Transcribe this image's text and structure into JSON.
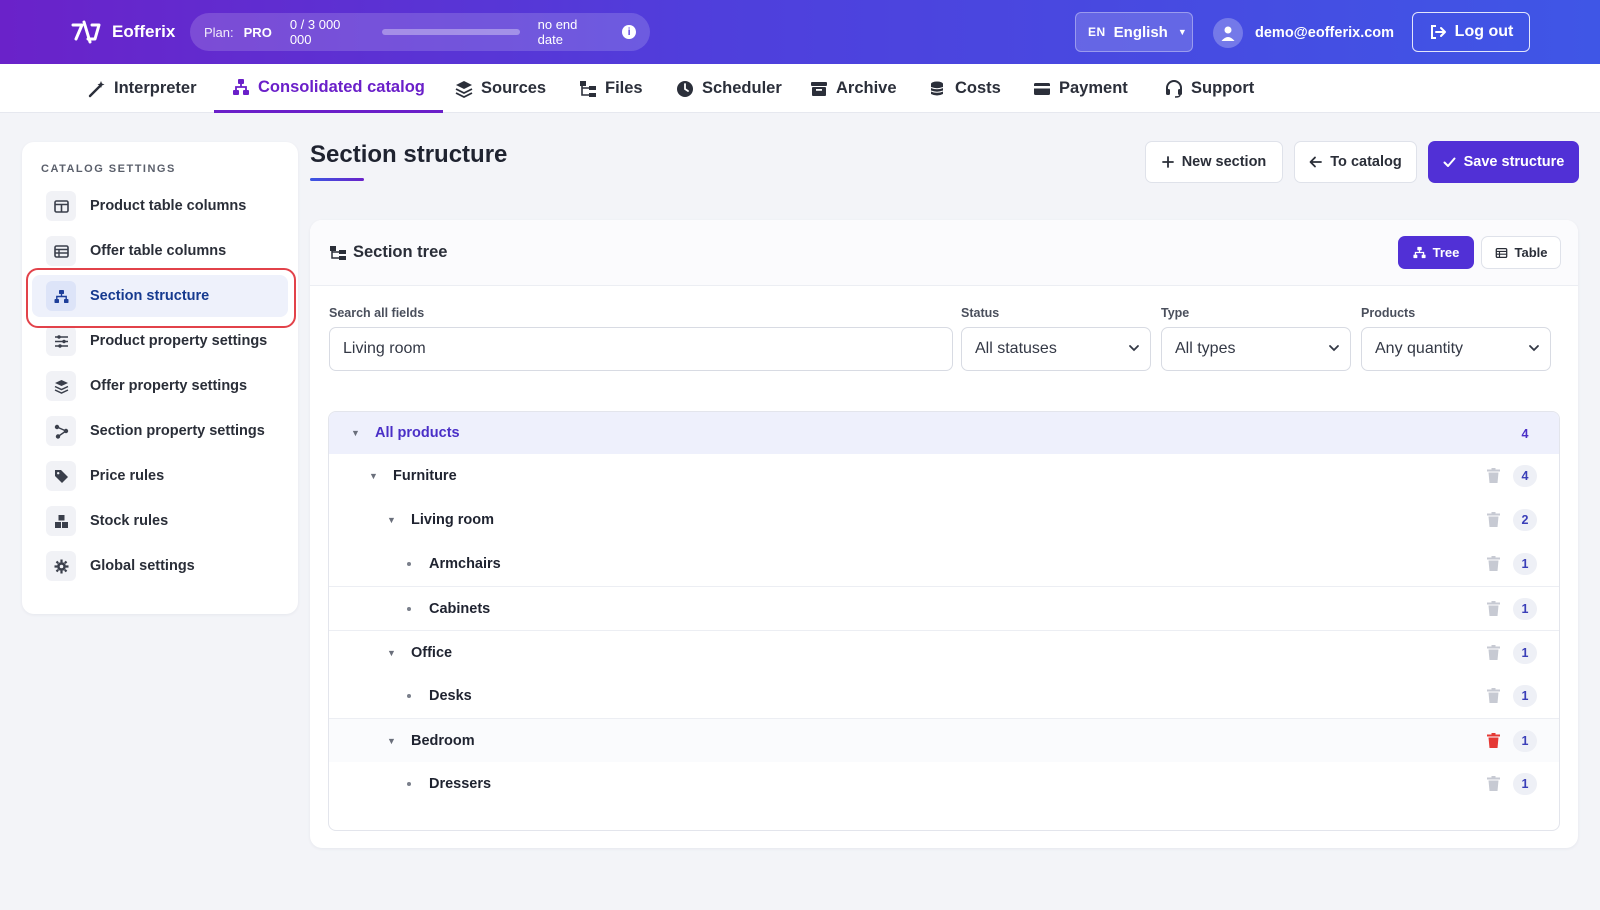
{
  "topbar": {
    "brand": "Eofferix",
    "plan_label": "Plan:",
    "plan_name": "PRO",
    "quota_text": "0  /  3 000 000",
    "quota_fraction": 0,
    "plan_expiry": "no end date",
    "lang_code": "EN",
    "lang_name": "English",
    "user_email": "demo@eofferix.com",
    "logout_label": "Log out"
  },
  "nav": {
    "items": [
      {
        "label": "Interpreter",
        "icon": "magic-wand-icon"
      },
      {
        "label": "Consolidated catalog",
        "icon": "sitemap-icon",
        "active": true
      },
      {
        "label": "Sources",
        "icon": "layers-icon"
      },
      {
        "label": "Files",
        "icon": "folder-tree-icon"
      },
      {
        "label": "Scheduler",
        "icon": "clock-icon"
      },
      {
        "label": "Archive",
        "icon": "archive-icon"
      },
      {
        "label": "Costs",
        "icon": "coins-icon"
      },
      {
        "label": "Payment",
        "icon": "credit-card-icon"
      },
      {
        "label": "Support",
        "icon": "headset-icon"
      }
    ]
  },
  "sidebar": {
    "title": "CATALOG SETTINGS",
    "items": [
      {
        "label": "Product table columns",
        "icon": "columns-icon"
      },
      {
        "label": "Offer table columns",
        "icon": "table-icon"
      },
      {
        "label": "Section structure",
        "icon": "sitemap-icon",
        "active": true
      },
      {
        "label": "Product property settings",
        "icon": "sliders-icon"
      },
      {
        "label": "Offer property settings",
        "icon": "layers-icon"
      },
      {
        "label": "Section property settings",
        "icon": "share-nodes-icon"
      },
      {
        "label": "Price rules",
        "icon": "tags-icon"
      },
      {
        "label": "Stock rules",
        "icon": "boxes-icon"
      },
      {
        "label": "Global settings",
        "icon": "gear-icon"
      }
    ]
  },
  "page": {
    "title": "Section structure",
    "new_section_label": "New section",
    "to_catalog_label": "To catalog",
    "save_label": "Save structure"
  },
  "panel": {
    "title": "Section tree",
    "view_tree_label": "Tree",
    "view_table_label": "Table"
  },
  "filters": {
    "search_label": "Search all fields",
    "search_value": "Living room",
    "status_label": "Status",
    "status_value": "All statuses",
    "type_label": "Type",
    "type_value": "All types",
    "products_label": "Products",
    "products_value": "Any quantity"
  },
  "tree": {
    "root": {
      "label": "All products",
      "count": "4"
    },
    "rows": [
      {
        "label": "Furniture",
        "count": "4",
        "level": 1,
        "expandable": true
      },
      {
        "label": "Living room",
        "count": "2",
        "level": 2,
        "expandable": true
      },
      {
        "label": "Armchairs",
        "count": "1",
        "level": 3,
        "expandable": false
      },
      {
        "label": "Cabinets",
        "count": "1",
        "level": 3,
        "expandable": false
      },
      {
        "label": "Office",
        "count": "1",
        "level": 2,
        "expandable": true
      },
      {
        "label": "Desks",
        "count": "1",
        "level": 3,
        "expandable": false
      },
      {
        "label": "Bedroom",
        "count": "1",
        "level": 2,
        "expandable": true
      },
      {
        "label": "Dressers",
        "count": "1",
        "level": 3,
        "expandable": false
      }
    ]
  },
  "colors": {
    "brand_purple": "#5130d6",
    "active_nav": "#6a1fc9",
    "highlight_red": "#e2424a",
    "danger_trash": "#e53935"
  }
}
